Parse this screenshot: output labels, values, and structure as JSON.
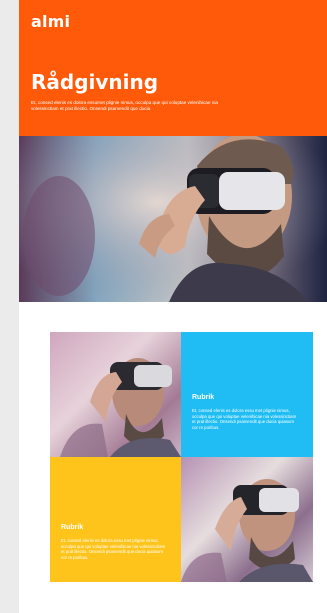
{
  "header": {
    "logo_text": "almi"
  },
  "hero": {
    "title": "Rådgivning",
    "text": "Et, consed elenis es dolora essumet plignie nimus, occulpa que qui voluptae velenihicae nia volessinctiam et prat illectio. Onsendi psamendit que ducia",
    "image_alt": "person-wearing-vr-headset"
  },
  "tiles": [
    {
      "type": "image",
      "image_alt": "person-wearing-vr-headset"
    },
    {
      "type": "text",
      "color": "#1fbdf3",
      "title": "Rubrik",
      "text": "Et, consed elenis es dolora essu met plignie nimus, occulpa que qui voluptae velenihicae nia volessinctiam et prat illectio. Onsendi psamendit que ducia quiasum cor re poribus."
    },
    {
      "type": "text",
      "color": "#ffc41b",
      "title": "Rubrik",
      "text": "Et, consed elenis es dolora essu met plignie nimus, occulpa que qui voluptae velenihicae nia volessinctiam et prat illectio. Onsendi psamendit que ducia quiasum cor re poribus."
    },
    {
      "type": "image",
      "image_alt": "person-wearing-vr-headset"
    }
  ],
  "colors": {
    "brand_orange": "#ff5a0a",
    "accent_blue": "#1fbdf3",
    "accent_yellow": "#ffc41b",
    "page_bg": "#ebebeb"
  }
}
